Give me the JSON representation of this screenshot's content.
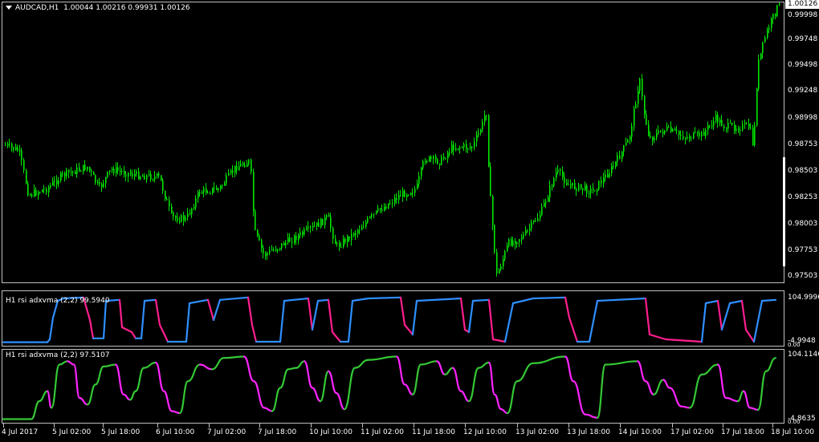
{
  "main": {
    "symbol": "AUDCAD,H1",
    "ohlc": "1.00044 1.00216 0.99931 1.00126",
    "dropdown_icon": "triangle-down-icon",
    "current_price": "1.00126",
    "candle_color": "#00e600",
    "price_levels": [
      "0.99998",
      "0.99748",
      "0.99498",
      "0.99248",
      "0.98998",
      "0.98753",
      "0.98503",
      "0.98253",
      "0.98003",
      "0.97753",
      "0.97503"
    ]
  },
  "ind1": {
    "title": "H1 rsi adxvma (2,2) 99.5940",
    "max_label": "104.9996",
    "min_label": "-4.9948",
    "zero_label": "0.00",
    "up_color": "#2f8fff",
    "down_color": "#ff1f8f"
  },
  "ind2": {
    "title": "H1 rsi adxvma (2,2) 97.5107",
    "max_label": "104.1146",
    "min_label": "-4.8635",
    "zero_label": "0.00",
    "up_color": "#35c735",
    "down_color": "#ff24ff"
  },
  "time_axis": [
    "4 Jul 2017",
    "5 Jul 02:00",
    "5 Jul 18:00",
    "6 Jul 10:00",
    "7 Jul 02:00",
    "7 Jul 18:00",
    "10 Jul 10:00",
    "11 Jul 02:00",
    "11 Jul 18:00",
    "12 Jul 10:00",
    "13 Jul 02:00",
    "13 Jul 18:00",
    "14 Jul 10:00",
    "17 Jul 02:00",
    "17 Jul 18:00",
    "18 Jul 10:00"
  ],
  "chart_data": {
    "type": "candlestick",
    "title": "AUDCAD,H1",
    "x": [
      "4 Jul 2017",
      "5 Jul 02:00",
      "5 Jul 18:00",
      "6 Jul 10:00",
      "7 Jul 02:00",
      "7 Jul 18:00",
      "10 Jul 10:00",
      "11 Jul 02:00",
      "11 Jul 18:00",
      "12 Jul 10:00",
      "13 Jul 02:00",
      "13 Jul 18:00",
      "14 Jul 10:00",
      "17 Jul 02:00",
      "17 Jul 18:00",
      "18 Jul 10:00"
    ],
    "close": [
      0.9878,
      0.9855,
      0.986,
      0.9815,
      0.984,
      0.9785,
      0.9805,
      0.982,
      0.986,
      0.9885,
      0.979,
      0.985,
      0.986,
      0.9895,
      0.9895,
      1.0012
    ],
    "ylim": [
      0.97503,
      1.00126
    ]
  }
}
